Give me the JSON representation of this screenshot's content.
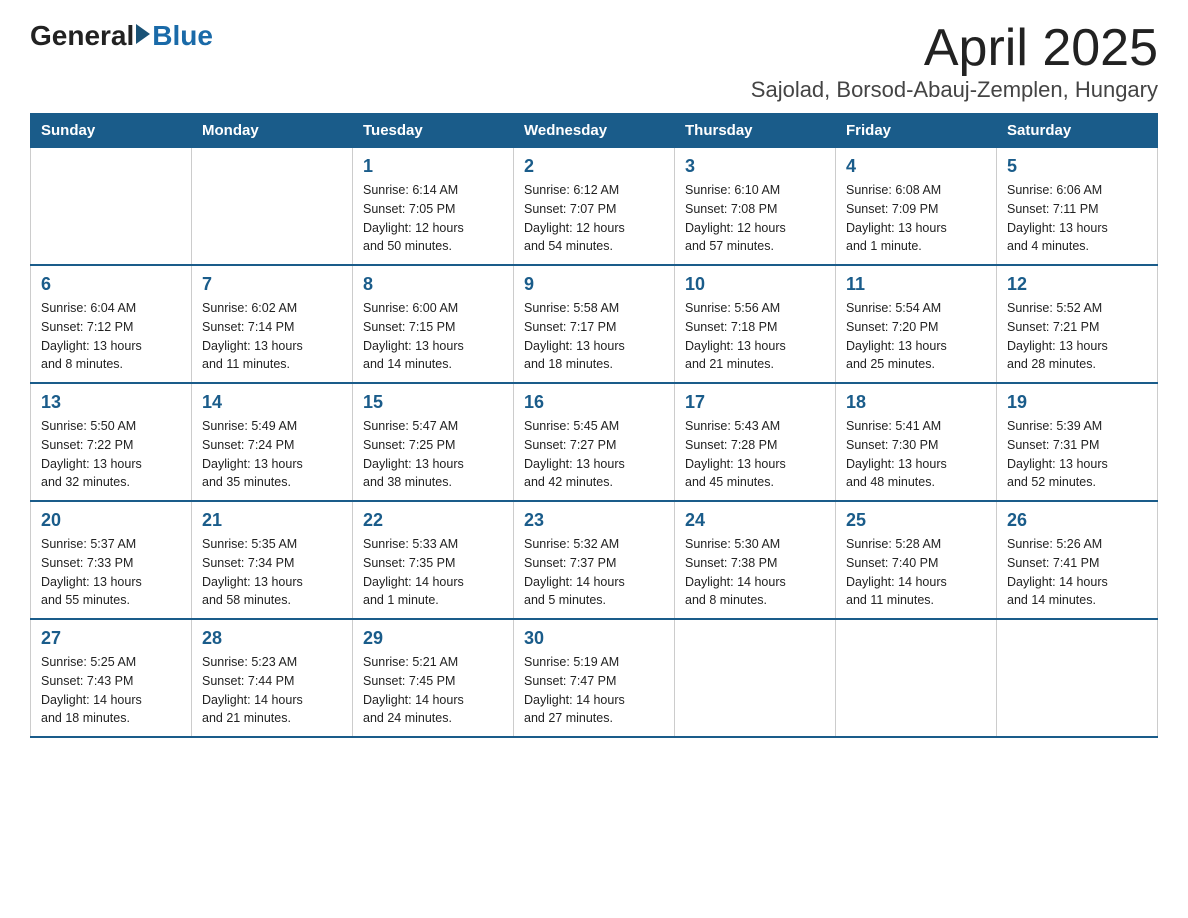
{
  "logo": {
    "general": "General",
    "blue": "Blue"
  },
  "title": "April 2025",
  "subtitle": "Sajolad, Borsod-Abauj-Zemplen, Hungary",
  "days_of_week": [
    "Sunday",
    "Monday",
    "Tuesday",
    "Wednesday",
    "Thursday",
    "Friday",
    "Saturday"
  ],
  "weeks": [
    [
      {
        "day": "",
        "info": ""
      },
      {
        "day": "",
        "info": ""
      },
      {
        "day": "1",
        "info": "Sunrise: 6:14 AM\nSunset: 7:05 PM\nDaylight: 12 hours\nand 50 minutes."
      },
      {
        "day": "2",
        "info": "Sunrise: 6:12 AM\nSunset: 7:07 PM\nDaylight: 12 hours\nand 54 minutes."
      },
      {
        "day": "3",
        "info": "Sunrise: 6:10 AM\nSunset: 7:08 PM\nDaylight: 12 hours\nand 57 minutes."
      },
      {
        "day": "4",
        "info": "Sunrise: 6:08 AM\nSunset: 7:09 PM\nDaylight: 13 hours\nand 1 minute."
      },
      {
        "day": "5",
        "info": "Sunrise: 6:06 AM\nSunset: 7:11 PM\nDaylight: 13 hours\nand 4 minutes."
      }
    ],
    [
      {
        "day": "6",
        "info": "Sunrise: 6:04 AM\nSunset: 7:12 PM\nDaylight: 13 hours\nand 8 minutes."
      },
      {
        "day": "7",
        "info": "Sunrise: 6:02 AM\nSunset: 7:14 PM\nDaylight: 13 hours\nand 11 minutes."
      },
      {
        "day": "8",
        "info": "Sunrise: 6:00 AM\nSunset: 7:15 PM\nDaylight: 13 hours\nand 14 minutes."
      },
      {
        "day": "9",
        "info": "Sunrise: 5:58 AM\nSunset: 7:17 PM\nDaylight: 13 hours\nand 18 minutes."
      },
      {
        "day": "10",
        "info": "Sunrise: 5:56 AM\nSunset: 7:18 PM\nDaylight: 13 hours\nand 21 minutes."
      },
      {
        "day": "11",
        "info": "Sunrise: 5:54 AM\nSunset: 7:20 PM\nDaylight: 13 hours\nand 25 minutes."
      },
      {
        "day": "12",
        "info": "Sunrise: 5:52 AM\nSunset: 7:21 PM\nDaylight: 13 hours\nand 28 minutes."
      }
    ],
    [
      {
        "day": "13",
        "info": "Sunrise: 5:50 AM\nSunset: 7:22 PM\nDaylight: 13 hours\nand 32 minutes."
      },
      {
        "day": "14",
        "info": "Sunrise: 5:49 AM\nSunset: 7:24 PM\nDaylight: 13 hours\nand 35 minutes."
      },
      {
        "day": "15",
        "info": "Sunrise: 5:47 AM\nSunset: 7:25 PM\nDaylight: 13 hours\nand 38 minutes."
      },
      {
        "day": "16",
        "info": "Sunrise: 5:45 AM\nSunset: 7:27 PM\nDaylight: 13 hours\nand 42 minutes."
      },
      {
        "day": "17",
        "info": "Sunrise: 5:43 AM\nSunset: 7:28 PM\nDaylight: 13 hours\nand 45 minutes."
      },
      {
        "day": "18",
        "info": "Sunrise: 5:41 AM\nSunset: 7:30 PM\nDaylight: 13 hours\nand 48 minutes."
      },
      {
        "day": "19",
        "info": "Sunrise: 5:39 AM\nSunset: 7:31 PM\nDaylight: 13 hours\nand 52 minutes."
      }
    ],
    [
      {
        "day": "20",
        "info": "Sunrise: 5:37 AM\nSunset: 7:33 PM\nDaylight: 13 hours\nand 55 minutes."
      },
      {
        "day": "21",
        "info": "Sunrise: 5:35 AM\nSunset: 7:34 PM\nDaylight: 13 hours\nand 58 minutes."
      },
      {
        "day": "22",
        "info": "Sunrise: 5:33 AM\nSunset: 7:35 PM\nDaylight: 14 hours\nand 1 minute."
      },
      {
        "day": "23",
        "info": "Sunrise: 5:32 AM\nSunset: 7:37 PM\nDaylight: 14 hours\nand 5 minutes."
      },
      {
        "day": "24",
        "info": "Sunrise: 5:30 AM\nSunset: 7:38 PM\nDaylight: 14 hours\nand 8 minutes."
      },
      {
        "day": "25",
        "info": "Sunrise: 5:28 AM\nSunset: 7:40 PM\nDaylight: 14 hours\nand 11 minutes."
      },
      {
        "day": "26",
        "info": "Sunrise: 5:26 AM\nSunset: 7:41 PM\nDaylight: 14 hours\nand 14 minutes."
      }
    ],
    [
      {
        "day": "27",
        "info": "Sunrise: 5:25 AM\nSunset: 7:43 PM\nDaylight: 14 hours\nand 18 minutes."
      },
      {
        "day": "28",
        "info": "Sunrise: 5:23 AM\nSunset: 7:44 PM\nDaylight: 14 hours\nand 21 minutes."
      },
      {
        "day": "29",
        "info": "Sunrise: 5:21 AM\nSunset: 7:45 PM\nDaylight: 14 hours\nand 24 minutes."
      },
      {
        "day": "30",
        "info": "Sunrise: 5:19 AM\nSunset: 7:47 PM\nDaylight: 14 hours\nand 27 minutes."
      },
      {
        "day": "",
        "info": ""
      },
      {
        "day": "",
        "info": ""
      },
      {
        "day": "",
        "info": ""
      }
    ]
  ]
}
